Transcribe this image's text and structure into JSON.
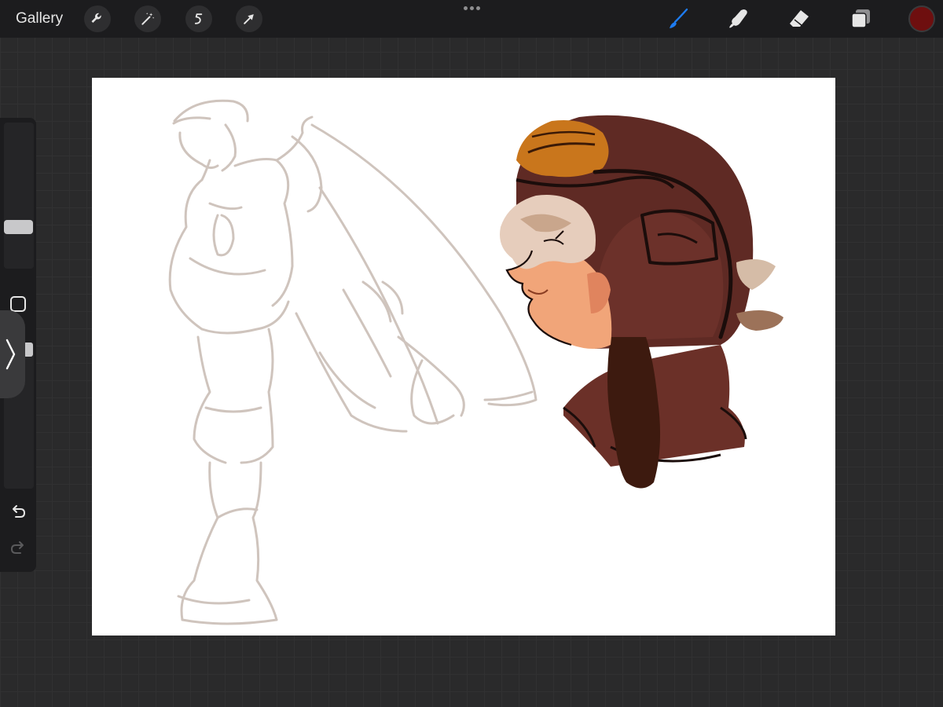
{
  "topbar": {
    "gallery_label": "Gallery",
    "left_tools": [
      "wrench-icon",
      "magic-wand-icon",
      "selection-s-icon",
      "transform-arrow-icon"
    ],
    "right_tools": [
      "brush-icon",
      "smudge-icon",
      "eraser-icon",
      "layers-icon"
    ]
  },
  "colors": {
    "current_color": "#6e0f0f",
    "active_tool": "#1e7cf2",
    "topbar_bg": "#1c1c1e",
    "canvas_bg": "#ffffff"
  },
  "sidebar": {
    "tools": [
      "brush-size-slider",
      "modify-square-icon",
      "opacity-slider",
      "undo-icon",
      "redo-icon"
    ]
  }
}
